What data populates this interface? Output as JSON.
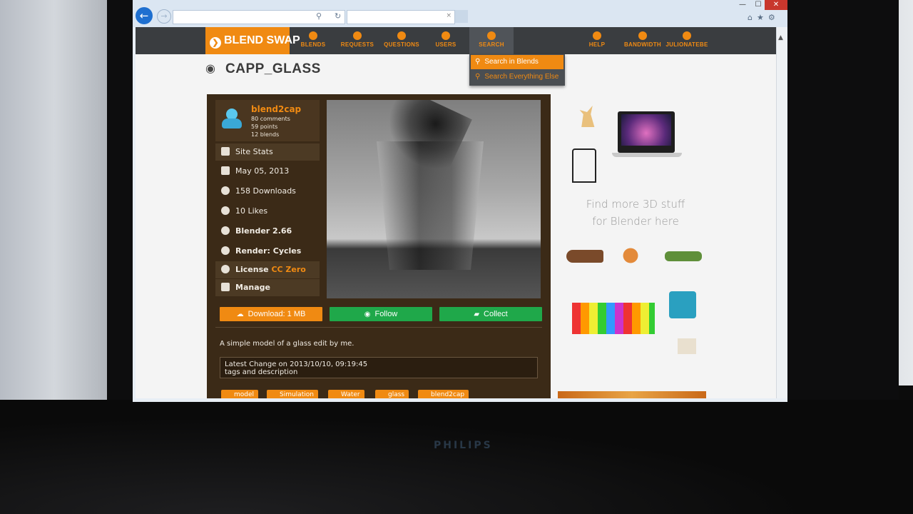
{
  "browser": {
    "window_controls": {
      "minimize": "—",
      "maximize": "☐",
      "close": "✕"
    },
    "address": {
      "value": "",
      "search_glyph": "⚲",
      "refresh_glyph": "↻"
    },
    "tab": {
      "label": "",
      "close": "×"
    },
    "toolbar_icons": [
      "home-icon",
      "star-icon",
      "gear-icon"
    ]
  },
  "site": {
    "logo_text": "BLEND SWAP",
    "nav": [
      {
        "label": "BLENDS"
      },
      {
        "label": "REQUESTS"
      },
      {
        "label": "QUESTIONS"
      },
      {
        "label": "USERS"
      },
      {
        "label": "SEARCH"
      },
      {
        "label": "HELP"
      },
      {
        "label": "BANDWIDTH"
      },
      {
        "label": "JULIONATEBE"
      }
    ],
    "search_dropdown": [
      "Search in Blends",
      "Search Everything Else"
    ]
  },
  "blend": {
    "title": "CAPP_GLASS",
    "author": {
      "name": "blend2cap",
      "comments": "80 comments",
      "points": "59 points",
      "blends": "12 blends"
    },
    "sidebar": {
      "site_stats": "Site Stats",
      "date": "May 05, 2013",
      "downloads": "158 Downloads",
      "likes": "10 Likes",
      "blender": "Blender 2.66",
      "render": "Render: Cycles",
      "license_label": "License",
      "license_value": "CC Zero",
      "manage": "Manage"
    },
    "buttons": {
      "download": "Download: 1 MB",
      "follow": "Follow",
      "collect": "Collect"
    },
    "description": "A simple model of a glass edit by me.",
    "latest_change": {
      "line1": "Latest Change on 2013/10/10, 09:19:45",
      "line2": "tags and description"
    },
    "tags": [
      "model",
      "Simulation",
      "Water",
      "glass",
      "blend2cap"
    ]
  },
  "ad": {
    "cta_line1": "Find more 3D stuff",
    "cta_line2": "for Blender here"
  },
  "monitor_brand": "PHILIPS",
  "colors": {
    "accent": "#f08a12",
    "green": "#1fa84a",
    "nav_bg": "#3a3d40",
    "card_bg": "#3b2a17"
  }
}
